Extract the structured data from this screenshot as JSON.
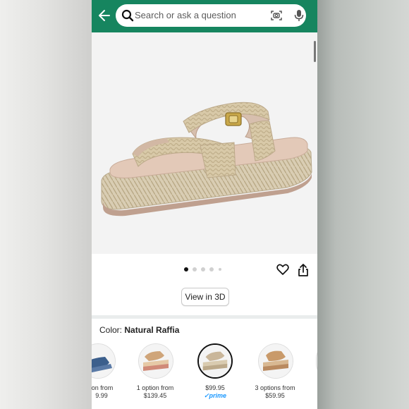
{
  "search": {
    "placeholder": "Search or ask a question"
  },
  "colors": {
    "header_bg": "#16855f",
    "prime_blue": "#1a98ff"
  },
  "gallery": {
    "image_count": 5,
    "selected_index": 0
  },
  "view3d_label": "View in 3D",
  "color_section": {
    "label": "Color:",
    "selected_color": "Natural Raffia"
  },
  "swatches": [
    {
      "line1": "ion from",
      "line2": "9.99"
    },
    {
      "line1": "1 option from",
      "line2": "$139.45"
    },
    {
      "line1": "$99.95",
      "line2": "✓prime"
    },
    {
      "line1": "3 options from",
      "line2": "$59.95"
    }
  ],
  "icons": [
    "back-arrow-icon",
    "search-icon",
    "camera-icon",
    "microphone-icon",
    "heart-icon",
    "share-icon"
  ]
}
